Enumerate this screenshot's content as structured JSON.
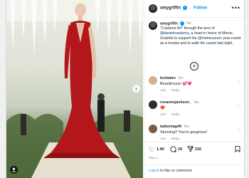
{
  "post": {
    "username": "amygriffin",
    "follow_label": "Follow",
    "more_label": "•••",
    "verified_mark": "✓"
  },
  "caption": {
    "username": "amygriffin",
    "time": "5w",
    "text_before": "\"Costume Art\" through the lens of ",
    "mention1": "@danielroseberry",
    "text_middle": ", a heart in honor of Merne. Grateful to support the ",
    "mention2": "@metmuseum",
    "text_after": " year-round as a trustee and to walk the carpet last night."
  },
  "comments": [
    {
      "username": "bcdware",
      "time": "5w",
      "text": "Beautimous!",
      "emoji": "💕💗",
      "like_label": "Like",
      "reply_label": "Reply",
      "avatar_color": "#d6b08c"
    },
    {
      "username": "roxannejackson_",
      "time": "5w",
      "text": "",
      "emoji": "❤️",
      "like_label": "Like",
      "reply_label": "Reply",
      "avatar_color": "#2d2d2d"
    },
    {
      "username": "ladonnag44",
      "time": "5w",
      "text": "Stunning!! You're gorgeous!",
      "emoji": "",
      "like_label": "Like",
      "reply_label": "Reply",
      "avatar_color": "#7a5c48"
    }
  ],
  "actions": {
    "likes": "1.9K",
    "comments": "29",
    "shares": "216",
    "heart_icon": "heart-icon",
    "comment_icon": "comment-icon",
    "share_icon": "share-icon",
    "save_icon": "bookmark-icon"
  },
  "date": "May 1",
  "login": {
    "link": "Log in",
    "rest": " to like or comment."
  },
  "colors": {
    "accent": "#0095f6",
    "dress": "#b3161b"
  }
}
